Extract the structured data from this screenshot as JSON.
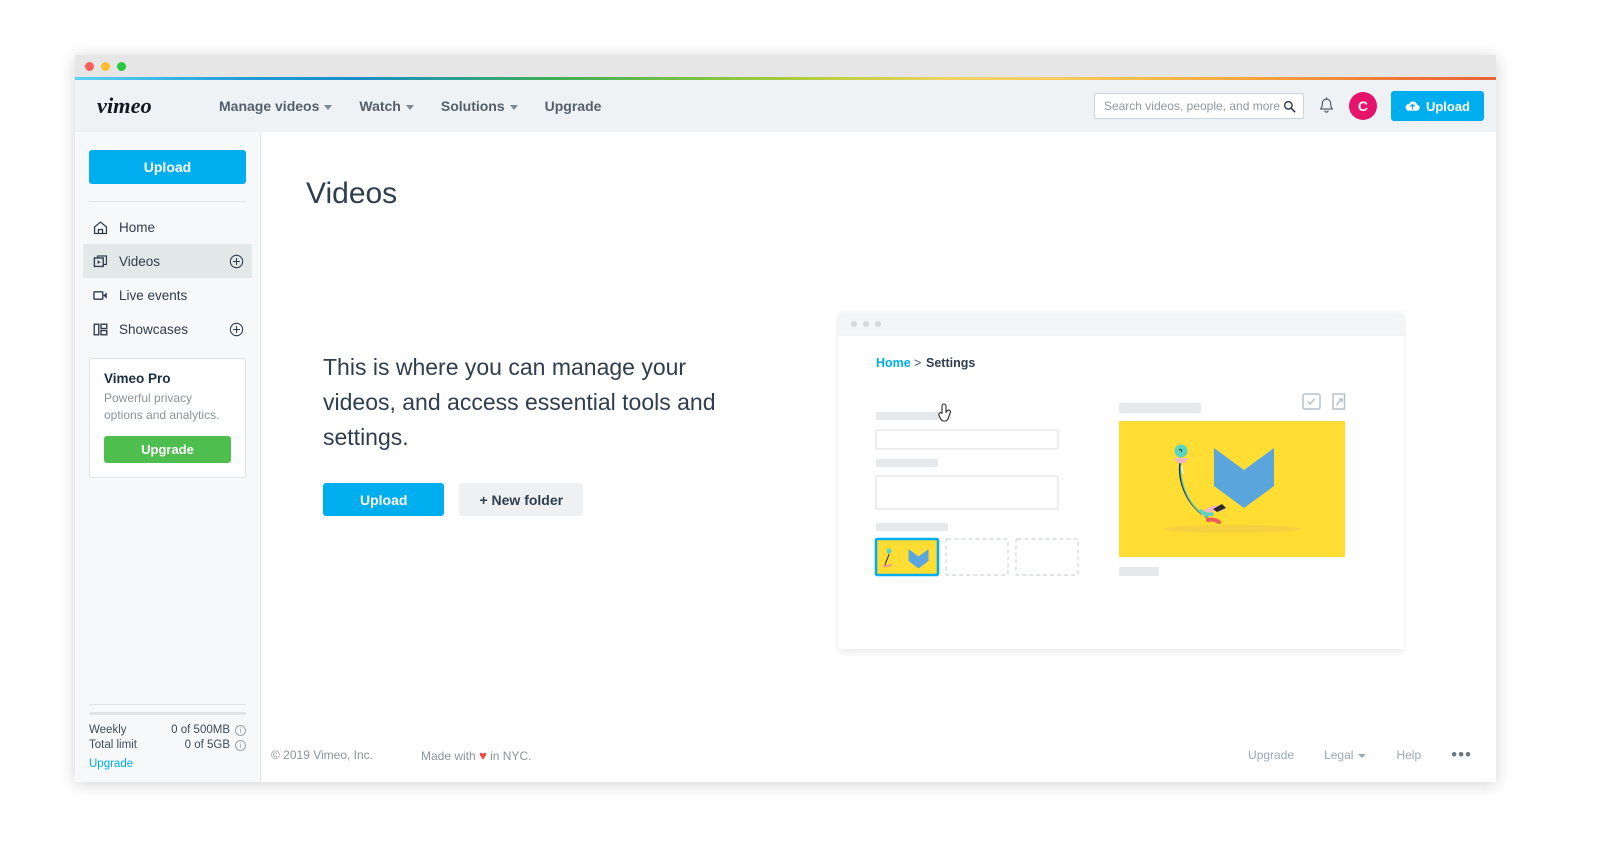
{
  "window": {
    "traffic_lights": [
      "close",
      "minimize",
      "zoom"
    ],
    "gradient_colors": [
      "#5cd2f5",
      "#1a8fc9",
      "#3fae55",
      "#b5cf3c",
      "#f7c95a",
      "#ec6337"
    ]
  },
  "topnav": {
    "brand": "vimeo",
    "links": [
      {
        "label": "Manage videos",
        "has_caret": true
      },
      {
        "label": "Watch",
        "has_caret": true
      },
      {
        "label": "Solutions",
        "has_caret": true
      },
      {
        "label": "Upgrade",
        "has_caret": false
      }
    ],
    "search": {
      "placeholder": "Search videos, people, and more",
      "value": ""
    },
    "notifications_icon": "bell-icon",
    "avatar": {
      "initial": "C",
      "color": "#e6136c"
    },
    "upload_label": "Upload"
  },
  "sidebar": {
    "upload_label": "Upload",
    "items": [
      {
        "label": "Home",
        "icon": "home-icon",
        "active": false,
        "has_plus": false
      },
      {
        "label": "Videos",
        "icon": "videos-icon",
        "active": true,
        "has_plus": true
      },
      {
        "label": "Live events",
        "icon": "live-events-icon",
        "active": false,
        "has_plus": false
      },
      {
        "label": "Showcases",
        "icon": "showcases-icon",
        "active": false,
        "has_plus": true
      }
    ],
    "pro_card": {
      "title": "Vimeo Pro",
      "description": "Powerful privacy options and analytics.",
      "button_label": "Upgrade",
      "button_color": "#4ebe4e"
    },
    "storage": {
      "rows": [
        {
          "label": "Weekly",
          "value": "0 of 500MB"
        },
        {
          "label": "Total limit",
          "value": "0 of 5GB"
        }
      ],
      "upgrade_link": "Upgrade",
      "progress_percent": 0
    }
  },
  "main": {
    "title": "Videos",
    "empty_text": "This is where you can manage your videos, and access essential tools and settings.",
    "upload_label": "Upload",
    "new_folder_label": "+ New folder"
  },
  "illustration": {
    "breadcrumb_home": "Home",
    "breadcrumb_separator": ">",
    "breadcrumb_current": "Settings",
    "banner_color": "#ffdd33",
    "hexagon_color": "#5ba7dd",
    "selected_thumb_border": "#00adef",
    "placeholder_color": "#e6e9ec",
    "cursor": "pointer-hand-cursor"
  },
  "footer": {
    "copyright": "© 2019 Vimeo, Inc.",
    "made_with_prefix": "Made with",
    "made_with_suffix": "in NYC.",
    "heart": "♥",
    "links": [
      {
        "label": "Upgrade",
        "has_caret": false
      },
      {
        "label": "Legal",
        "has_caret": true
      },
      {
        "label": "Help",
        "has_caret": false
      }
    ],
    "more_label": "•••"
  }
}
